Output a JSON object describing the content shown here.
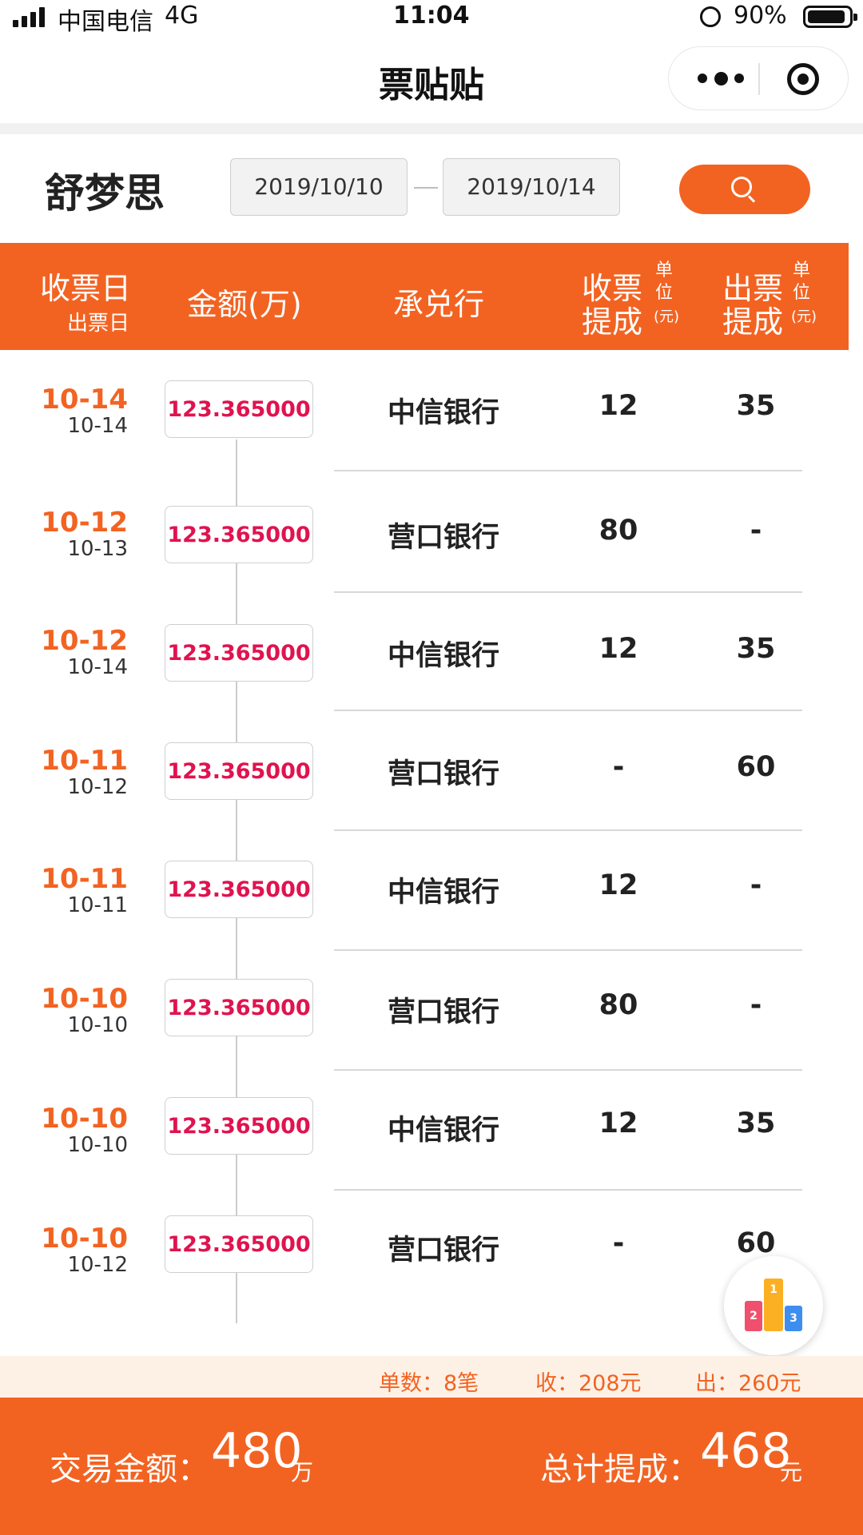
{
  "status_bar": {
    "carrier": "中国电信",
    "network": "4G",
    "time": "11:04",
    "battery": "90%"
  },
  "nav": {
    "title": "票贴贴",
    "more_icon": "more-dots-icon",
    "close_icon": "target-circle-icon"
  },
  "filter": {
    "company": "舒梦思",
    "start_date": "2019/10/10",
    "end_date": "2019/10/14",
    "search_icon": "search-icon"
  },
  "table_header": {
    "col1_main": "收票日",
    "col1_sub": "出票日",
    "col2": "金额(万)",
    "col3": "承兑行",
    "col4_line1": "收票",
    "col4_line2": "提成",
    "col4_unit": [
      "单",
      "位",
      "(元)"
    ],
    "col5_line1": "出票",
    "col5_line2": "提成",
    "col5_unit": [
      "单",
      "位",
      "(元)"
    ]
  },
  "rows": [
    {
      "receive_date": "10-14",
      "issue_date": "10-14",
      "amount": "123.365000",
      "bank": "中信银行",
      "receive_commission": "12",
      "issue_commission": "35"
    },
    {
      "receive_date": "10-12",
      "issue_date": "10-13",
      "amount": "123.365000",
      "bank": "营口银行",
      "receive_commission": "80",
      "issue_commission": "-"
    },
    {
      "receive_date": "10-12",
      "issue_date": "10-14",
      "amount": "123.365000",
      "bank": "中信银行",
      "receive_commission": "12",
      "issue_commission": "35"
    },
    {
      "receive_date": "10-11",
      "issue_date": "10-12",
      "amount": "123.365000",
      "bank": "营口银行",
      "receive_commission": "-",
      "issue_commission": "60"
    },
    {
      "receive_date": "10-11",
      "issue_date": "10-11",
      "amount": "123.365000",
      "bank": "中信银行",
      "receive_commission": "12",
      "issue_commission": "-"
    },
    {
      "receive_date": "10-10",
      "issue_date": "10-10",
      "amount": "123.365000",
      "bank": "营口银行",
      "receive_commission": "80",
      "issue_commission": "-"
    },
    {
      "receive_date": "10-10",
      "issue_date": "10-10",
      "amount": "123.365000",
      "bank": "中信银行",
      "receive_commission": "12",
      "issue_commission": "35"
    },
    {
      "receive_date": "10-10",
      "issue_date": "10-12",
      "amount": "123.365000",
      "bank": "营口银行",
      "receive_commission": "-",
      "issue_commission": "60"
    }
  ],
  "ranking": {
    "icon": "podium-ranking-icon",
    "ranks": [
      "1",
      "2",
      "3"
    ]
  },
  "summary": {
    "count": "单数：8笔",
    "receive": "收：208元",
    "issue": "出：260元"
  },
  "footer": {
    "trade_label": "交易金额：",
    "trade_value": "480",
    "trade_unit": "万",
    "total_label": "总计提成：",
    "total_value": "468",
    "total_unit": "元"
  },
  "colors": {
    "accent": "#f26322",
    "amount_text": "#e0134f",
    "summary_bg": "#fdf1e6"
  }
}
